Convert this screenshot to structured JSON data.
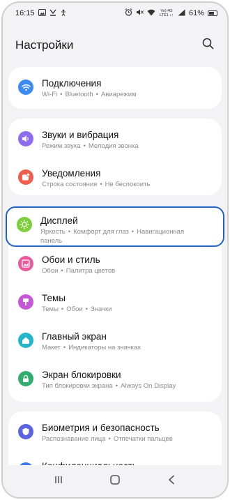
{
  "statusbar": {
    "time": "16:15",
    "net_label": "Vo) 4G LTE1 ↓↑",
    "battery_percent": "61%"
  },
  "header": {
    "title": "Настройки"
  },
  "items": [
    {
      "title": "Подключения",
      "sub": [
        "Wi-Fi",
        "Bluetooth",
        "Авиарежим"
      ],
      "icon": "wifi-icon",
      "color": "#3d8bf0"
    },
    {
      "title": "Звуки и вибрация",
      "sub": [
        "Режим звука",
        "Мелодия звонка"
      ],
      "icon": "speaker-icon",
      "color": "#8d6cf0"
    },
    {
      "title": "Уведомления",
      "sub": [
        "Строка состояния",
        "Не беспокоить"
      ],
      "icon": "bell-icon",
      "color": "#ef5f4e"
    },
    {
      "title": "Дисплей",
      "sub": [
        "Яркость",
        "Комфорт для глаз",
        "Навигационная"
      ],
      "sub2": "панель",
      "icon": "sun-icon",
      "color": "#7ccf3a"
    },
    {
      "title": "Обои и стиль",
      "sub": [
        "Обои",
        "Палитра цветов"
      ],
      "icon": "wallpaper-icon",
      "color": "#e85a9c"
    },
    {
      "title": "Темы",
      "sub": [
        "Темы",
        "Обои",
        "Значки"
      ],
      "icon": "themes-icon",
      "color": "#c657d6"
    },
    {
      "title": "Главный экран",
      "sub": [
        "Макет",
        "Индикаторы на значках"
      ],
      "icon": "home-icon",
      "color": "#27b6c9"
    },
    {
      "title": "Экран блокировки",
      "sub": [
        "Тип блокировки экрана",
        "Always On Display"
      ],
      "icon": "lock-icon",
      "color": "#2fae6d"
    },
    {
      "title": "Биометрия и безопасность",
      "sub": [
        "Распознавание лица",
        "Отпечатки пальцев"
      ],
      "icon": "shield-icon",
      "color": "#5b63e0"
    },
    {
      "title": "Конфиденциальность",
      "sub": [],
      "icon": "privacy-icon",
      "color": "#3d7bf0"
    }
  ]
}
